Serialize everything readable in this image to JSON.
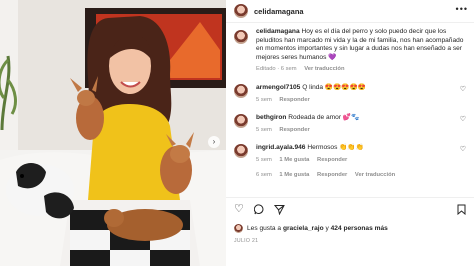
{
  "post": {
    "image_alt": "Woman in yellow top holding three small dogs on a white sofa",
    "next_arrow": "›"
  },
  "header": {
    "username": "celidamagana",
    "more": "•••"
  },
  "caption": {
    "username": "celidamagana",
    "text": "Hoy es el día del perro y solo puedo decir que los peluditos han marcado mi vida y la de mi familia, nos han acompañado en momentos importantes y sin lugar a dudas nos han enseñado a ser mejores seres humanos 💜",
    "edited": "Editado · 6 sem",
    "translation": "Ver traducción"
  },
  "comments": [
    {
      "username": "armengol7105",
      "text": "Q linda 😍😍😍😍😍",
      "time": "5 sem",
      "actions": [
        "Responder"
      ]
    },
    {
      "username": "bethgiron",
      "text": "Rodeada de amor 💕🐾",
      "time": "5 sem",
      "actions": [
        "Responder"
      ]
    },
    {
      "username": "ingrid.ayala.946",
      "text": "Hermosos 👏👏👏",
      "time": "5 sem",
      "actions": [
        "1 Me gusta",
        "Responder"
      ]
    },
    {
      "username": "",
      "text": "",
      "time": "6 sem",
      "actions": [
        "1 Me gusta",
        "Responder",
        "Ver traducción"
      ]
    }
  ],
  "likes": {
    "prefix": "Les gusta a",
    "user": "graciela_rajo",
    "middle": "y",
    "count": "424 personas más"
  },
  "date": "JULIO 21",
  "colors": {
    "text": "#262626",
    "meta": "#8e8e8e",
    "border": "#efefef"
  }
}
